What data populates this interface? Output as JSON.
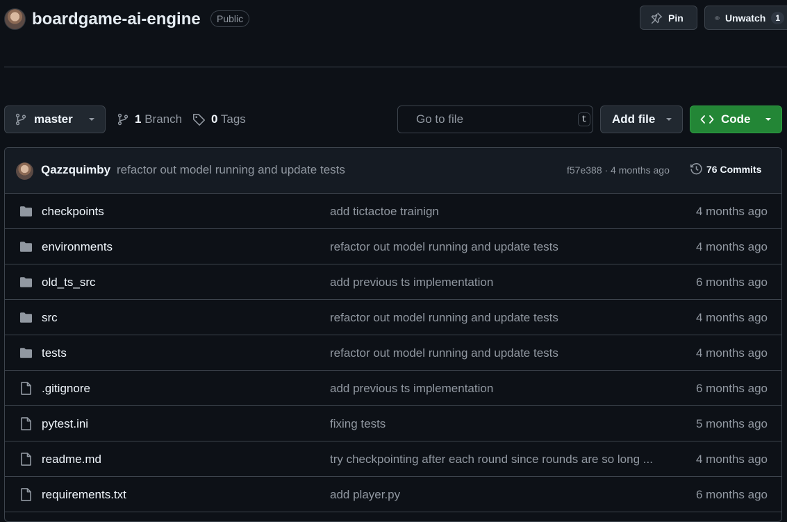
{
  "repo": {
    "name": "boardgame-ai-engine",
    "visibility": "Public"
  },
  "header_actions": {
    "pin_label": "Pin",
    "unwatch_label": "Unwatch",
    "unwatch_count": "1"
  },
  "toolbar": {
    "branch": "master",
    "branch_count": "1",
    "branch_label": "Branch",
    "tag_count": "0",
    "tag_label": "Tags",
    "search_placeholder": "Go to file",
    "search_shortcut": "t",
    "add_file_label": "Add file",
    "code_label": "Code"
  },
  "latest_commit": {
    "author": "Qazzquimby",
    "message": "refactor out model running and update tests",
    "sha_and_time": "f57e388 · 4 months ago",
    "commits_label": "76 Commits"
  },
  "files": [
    {
      "type": "folder",
      "name": "checkpoints",
      "message": "add tictactoe trainign",
      "date": "4 months ago"
    },
    {
      "type": "folder",
      "name": "environments",
      "message": "refactor out model running and update tests",
      "date": "4 months ago"
    },
    {
      "type": "folder",
      "name": "old_ts_src",
      "message": "add previous ts implementation",
      "date": "6 months ago"
    },
    {
      "type": "folder",
      "name": "src",
      "message": "refactor out model running and update tests",
      "date": "4 months ago"
    },
    {
      "type": "folder",
      "name": "tests",
      "message": "refactor out model running and update tests",
      "date": "4 months ago"
    },
    {
      "type": "file",
      "name": ".gitignore",
      "message": "add previous ts implementation",
      "date": "6 months ago"
    },
    {
      "type": "file",
      "name": "pytest.ini",
      "message": "fixing tests",
      "date": "5 months ago"
    },
    {
      "type": "file",
      "name": "readme.md",
      "message": "try checkpointing after each round since rounds are so long ...",
      "date": "4 months ago"
    },
    {
      "type": "file",
      "name": "requirements.txt",
      "message": "add player.py",
      "date": "6 months ago"
    }
  ],
  "colors": {
    "background": "#0d1117",
    "code_button": "#238636",
    "muted_text": "#9198a1"
  }
}
